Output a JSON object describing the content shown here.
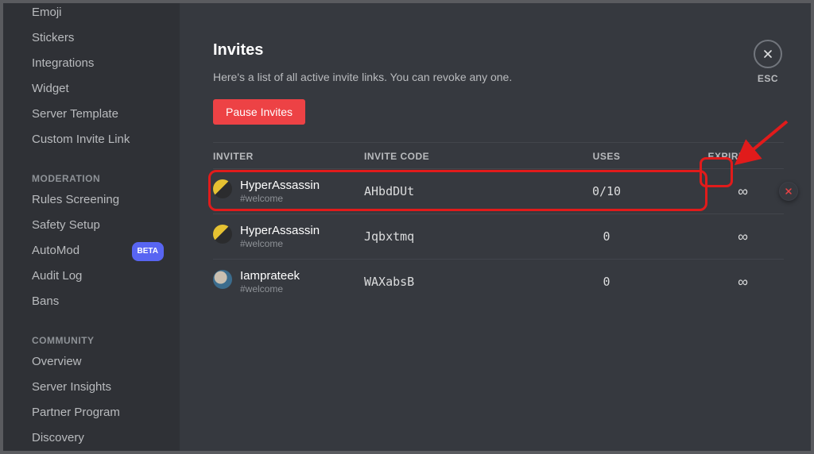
{
  "sidebar": {
    "items_top": [
      "Emoji",
      "Stickers",
      "Integrations",
      "Widget",
      "Server Template",
      "Custom Invite Link"
    ],
    "header_moderation": "MODERATION",
    "items_moderation": [
      "Rules Screening",
      "Safety Setup",
      "AutoMod",
      "Audit Log",
      "Bans"
    ],
    "beta_label": "BETA",
    "header_community": "COMMUNITY",
    "items_community": [
      "Overview",
      "Server Insights",
      "Partner Program",
      "Discovery"
    ]
  },
  "page": {
    "title": "Invites",
    "description": "Here's a list of all active invite links. You can revoke any one.",
    "pause_button": "Pause Invites",
    "esc_label": "ESC"
  },
  "table": {
    "headers": {
      "inviter": "INVITER",
      "code": "INVITE CODE",
      "uses": "USES",
      "expires": "EXPIRES"
    },
    "rows": [
      {
        "name": "HyperAssassin",
        "channel": "#welcome",
        "code": "AHbdDUt",
        "uses": "0/10",
        "expires": "∞"
      },
      {
        "name": "HyperAssassin",
        "channel": "#welcome",
        "code": "Jqbxtmq",
        "uses": "0",
        "expires": "∞"
      },
      {
        "name": "Iamprateek",
        "channel": "#welcome",
        "code": "WAXabsB",
        "uses": "0",
        "expires": "∞"
      }
    ]
  },
  "colors": {
    "accent_danger": "#ed4245",
    "brand": "#5865f2",
    "bg_main": "#36393f",
    "bg_side": "#2f3136"
  }
}
